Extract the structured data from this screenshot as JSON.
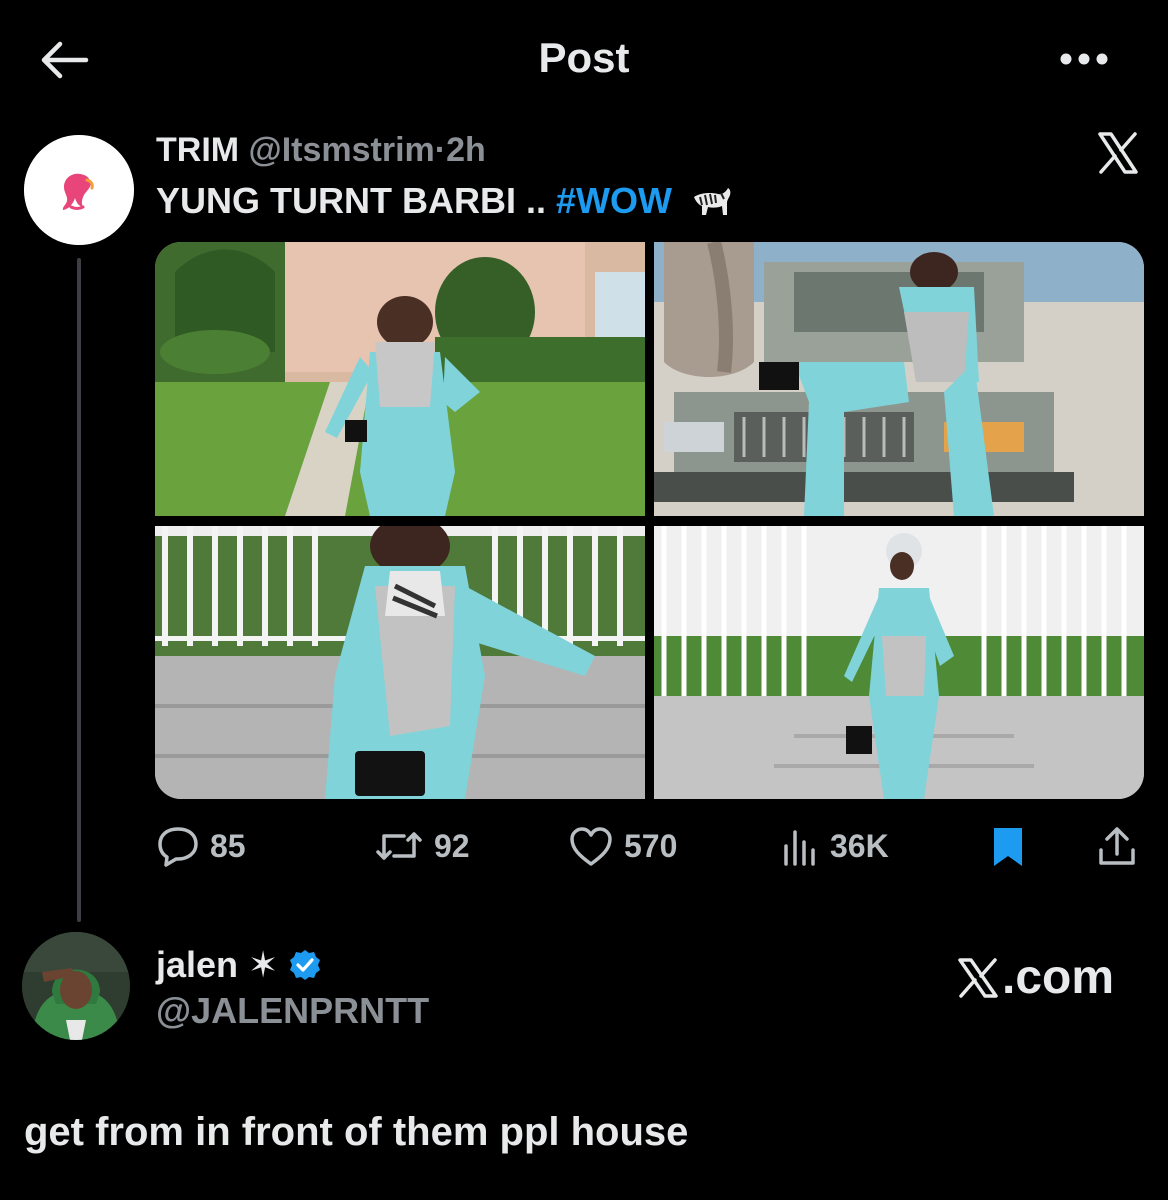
{
  "header": {
    "title": "Post",
    "back_icon": "arrow-left-icon",
    "more_icon": "more-horizontal-icon"
  },
  "quoted_post": {
    "author_name": "TRIM",
    "author_handle": "@Itsmstrim",
    "separator": "·",
    "time": "2h",
    "text_prefix": "YUNG TURNT BARBI .. ",
    "hashtag": "#WOW",
    "emoji_icon": "zebra-icon",
    "avatar_icon": "barbie-logo-icon",
    "platform_icon": "x-logo-icon",
    "stats": {
      "replies": "85",
      "reposts": "92",
      "likes": "570",
      "views": "36K"
    },
    "bookmarked": true
  },
  "reply_user": {
    "name": "jalen ✶",
    "handle": "@JALENPRNTT",
    "verified": true,
    "site_label": ".com"
  },
  "caption": "get from in front of them ppl house",
  "colors": {
    "background": "#000000",
    "text": "#e7e9ea",
    "muted": "#8b9096",
    "accent": "#1d9bf0"
  }
}
